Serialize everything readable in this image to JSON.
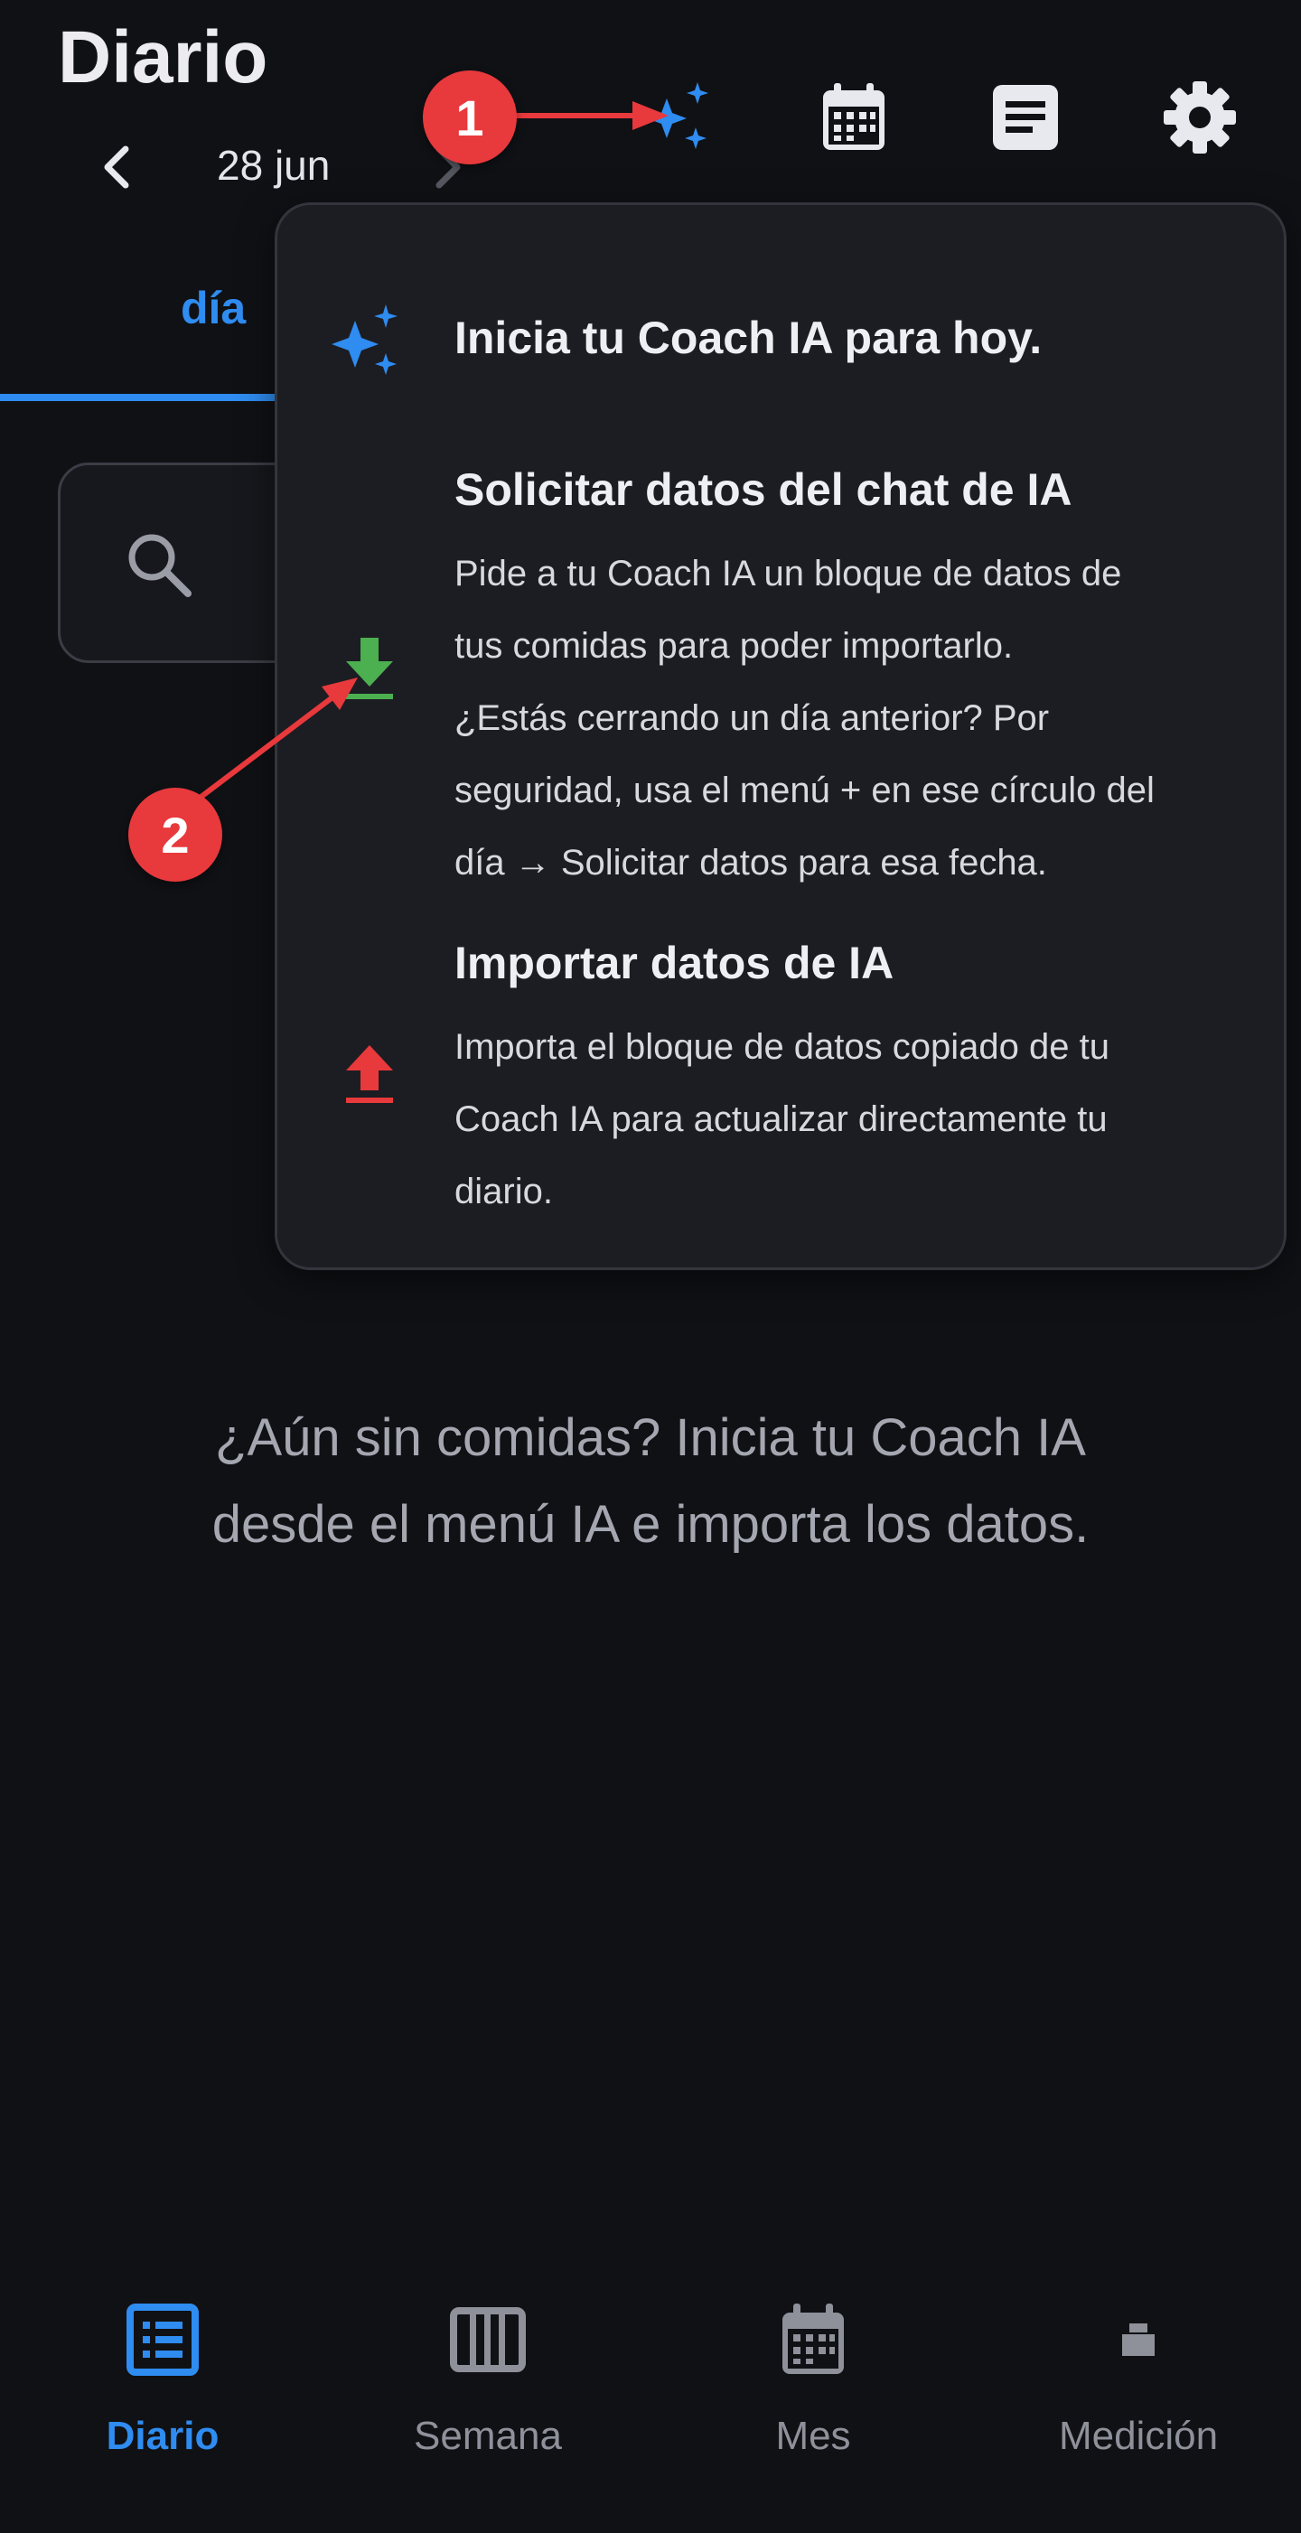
{
  "header": {
    "title": "Diario",
    "date": "28 jun"
  },
  "tabs": {
    "active": "día"
  },
  "popup": {
    "start_coach": "Inicia tu Coach IA para hoy.",
    "request": {
      "title": "Solicitar datos del chat de IA",
      "lines": [
        "Pide a tu Coach IA un bloque de datos de",
        "tus comidas para poder importarlo.",
        "¿Estás cerrando un día anterior? Por",
        "seguridad, usa el menú + en ese círculo del",
        "día → Solicitar datos para esa fecha."
      ]
    },
    "import": {
      "title": "Importar datos de IA",
      "lines": [
        "Importa el bloque de datos copiado de tu",
        "Coach IA para actualizar directamente tu",
        "diario."
      ]
    }
  },
  "empty_state": {
    "line1": "¿Aún sin comidas? Inicia tu Coach IA",
    "line2": "desde el menú IA e importa los datos."
  },
  "annotations": {
    "badge1": "1",
    "badge2": "2"
  },
  "bottom_nav": {
    "items": [
      {
        "label": "Diario",
        "icon": "list-icon"
      },
      {
        "label": "Semana",
        "icon": "week-columns-icon"
      },
      {
        "label": "Mes",
        "icon": "calendar-month-icon"
      },
      {
        "label": "Medición",
        "icon": "measurement-icon"
      }
    ]
  },
  "colors": {
    "accent": "#2f8cf0",
    "download_green": "#4caf50",
    "upload_red": "#e8393c",
    "background": "#101115",
    "popup": "#1c1d22"
  }
}
